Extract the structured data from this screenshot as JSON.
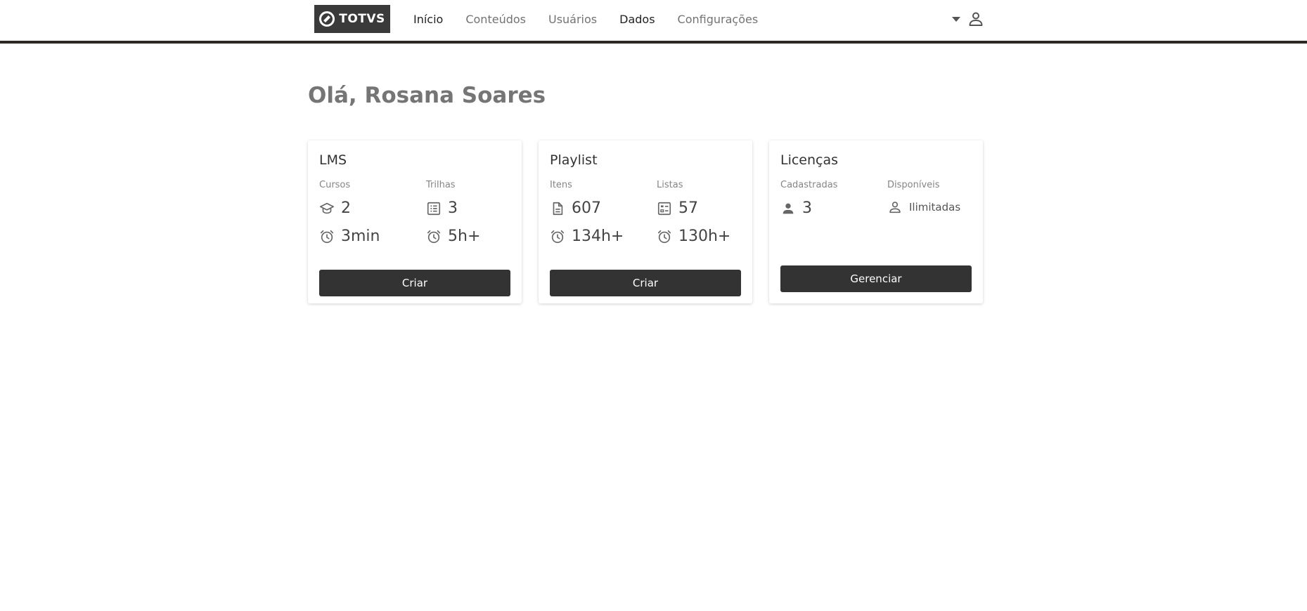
{
  "header": {
    "logo_text": "TOTVS",
    "nav": [
      {
        "label": "Início"
      },
      {
        "label": "Conteúdos"
      },
      {
        "label": "Usuários"
      },
      {
        "label": "Dados"
      },
      {
        "label": "Configurações"
      }
    ],
    "icons": {
      "dropdown": "chevron-down-icon",
      "user": "user-icon"
    }
  },
  "greeting": "Olá, Rosana Soares",
  "cards": {
    "lms": {
      "title": "LMS",
      "col1_label": "Cursos",
      "col2_label": "Trilhas",
      "cursos_count": "2",
      "trilhas_count": "3",
      "cursos_time": "3min",
      "trilhas_time": "5h+",
      "button": "Criar"
    },
    "playlist": {
      "title": "Playlist",
      "col1_label": "Itens",
      "col2_label": "Listas",
      "itens_count": "607",
      "listas_count": "57",
      "itens_time": "134h+",
      "listas_time": "130h+",
      "button": "Criar"
    },
    "licencas": {
      "title": "Licenças",
      "col1_label": "Cadastradas",
      "col2_label": "Disponíveis",
      "cadastradas_count": "3",
      "disponiveis_value": "Ilimitadas",
      "button": "Gerenciar"
    }
  },
  "colors": {
    "primary_dark": "#333333",
    "header_border": "#2e2724",
    "muted_text": "#757575"
  }
}
